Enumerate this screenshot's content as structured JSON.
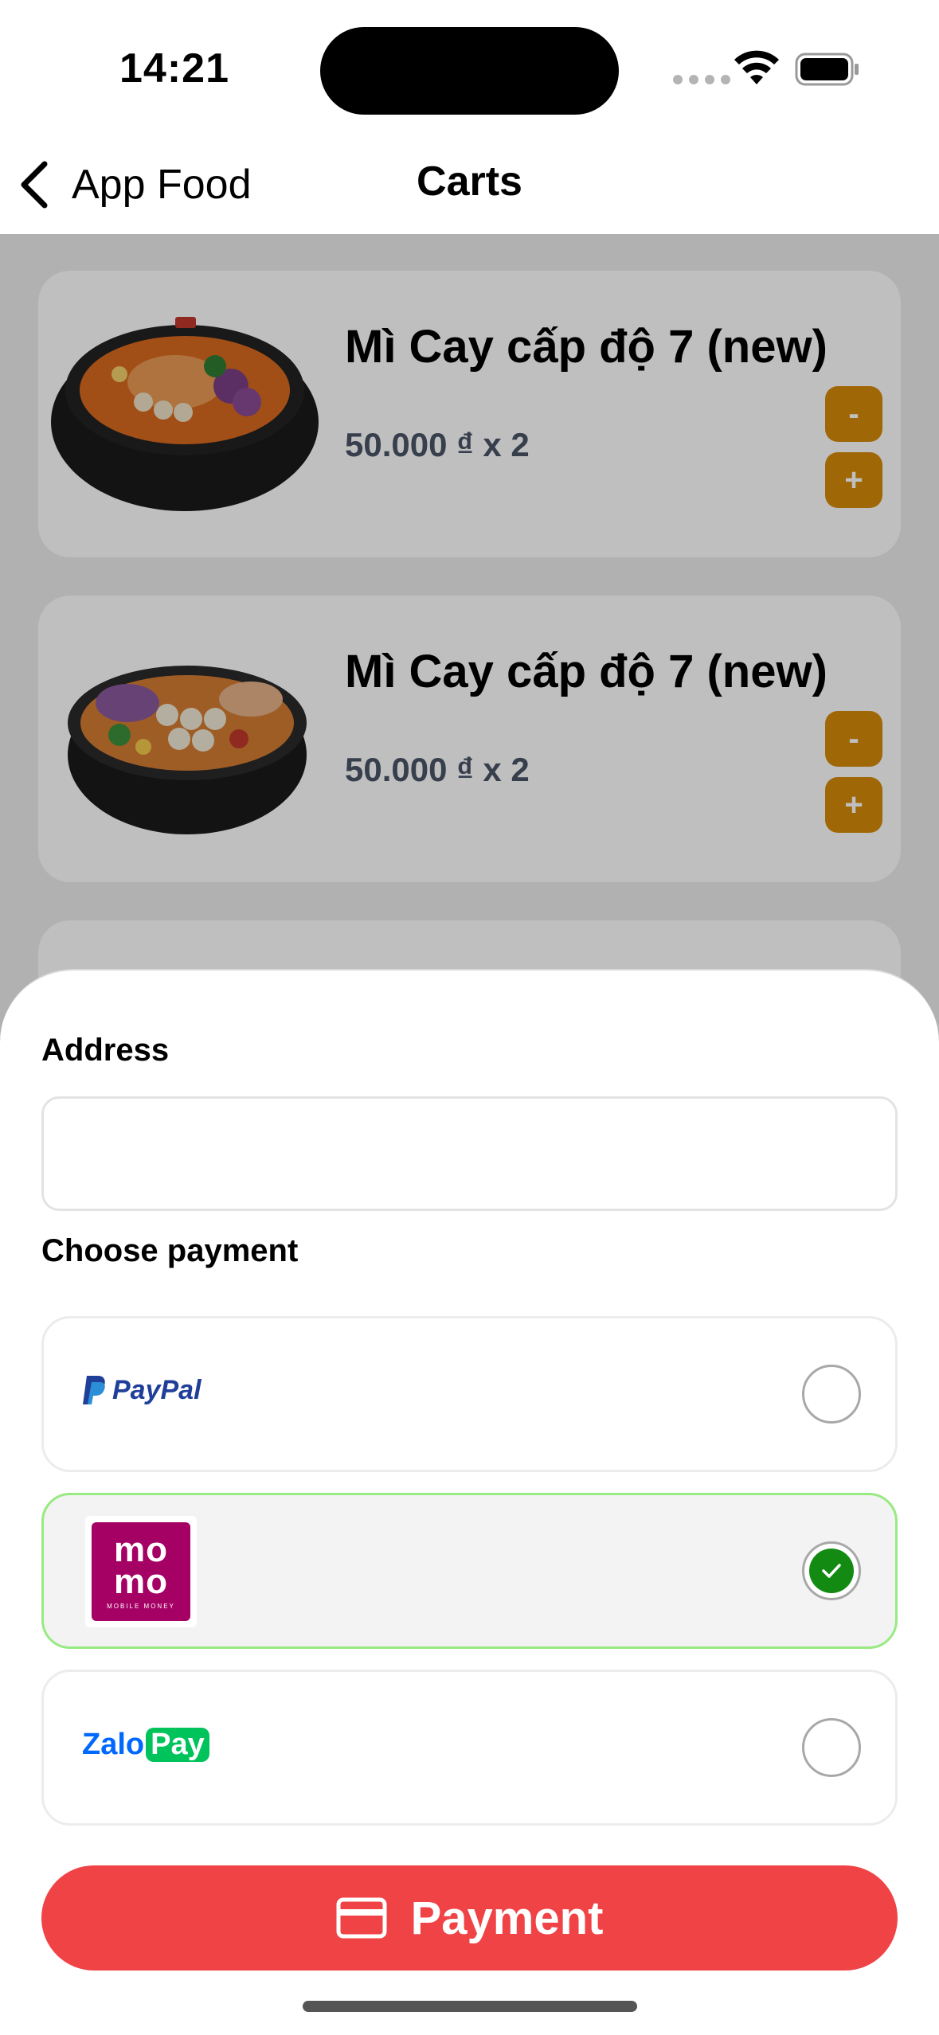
{
  "status_bar": {
    "time": "14:21"
  },
  "nav": {
    "back_label": "App Food",
    "title": "Carts"
  },
  "cart": {
    "items": [
      {
        "name": "Mì Cay cấp độ 7 (new)",
        "price": "50.000 ₫ x 2",
        "minus": "-",
        "plus": "+"
      },
      {
        "name": "Mì Cay cấp độ 7 (new)",
        "price": "50.000 ₫ x 2",
        "minus": "-",
        "plus": "+"
      }
    ]
  },
  "sheet": {
    "address_label": "Address",
    "address_value": "",
    "payment_label": "Choose payment",
    "options": [
      {
        "name": "PayPal",
        "selected": false
      },
      {
        "name": "momo",
        "sub": "MOBILE MONEY",
        "selected": true
      },
      {
        "name_a": "Zalo",
        "name_b": "Pay",
        "selected": false
      }
    ],
    "pay_button": "Payment"
  },
  "colors": {
    "accent_red": "#f04346",
    "qty_button": "#d68a0a",
    "selected_border": "#98ea82",
    "check_green": "#138a12",
    "momo_brand": "#a50064"
  }
}
